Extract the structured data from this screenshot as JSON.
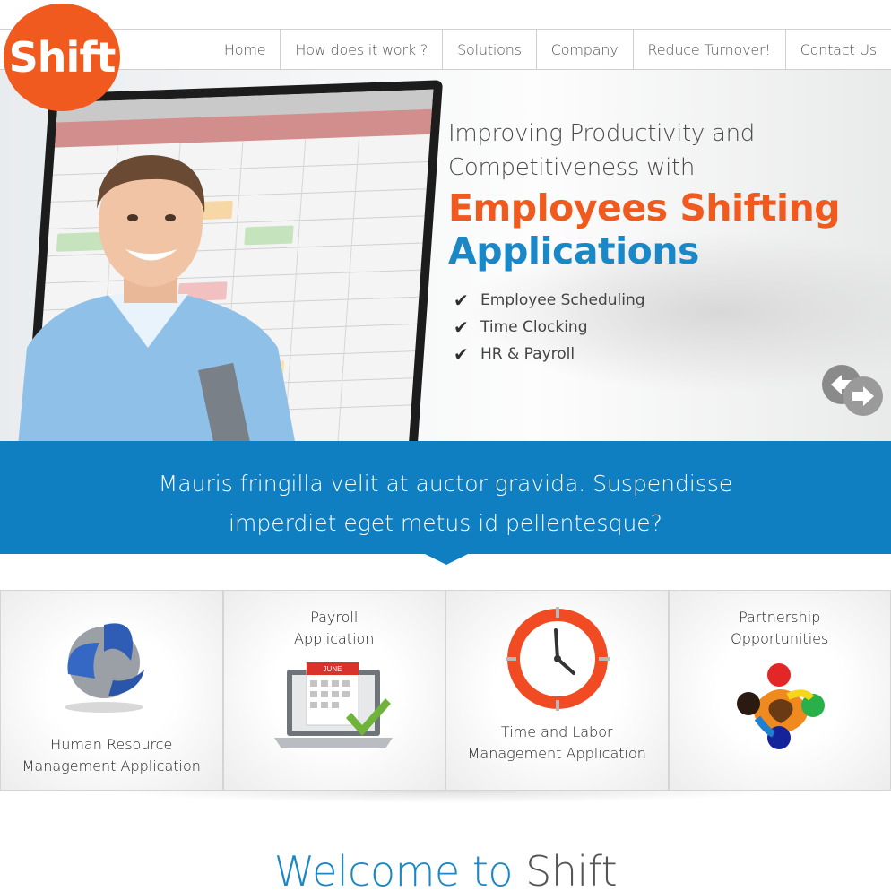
{
  "brand": {
    "logo_text": "Shift",
    "accent_orange": "#f05a1e",
    "accent_blue": "#0f7fc2"
  },
  "nav": {
    "items": [
      {
        "label": "Home"
      },
      {
        "label": "How does it work ?"
      },
      {
        "label": "Solutions"
      },
      {
        "label": "Company"
      },
      {
        "label": "Reduce Turnover!"
      },
      {
        "label": "Contact Us"
      }
    ]
  },
  "hero": {
    "intro_line1": "Improving Productivity and",
    "intro_line2": "Competitiveness with",
    "headline_orange": "Employees Shifting",
    "headline_blue": "Applications",
    "checks": [
      {
        "label": "Employee Scheduling"
      },
      {
        "label": "Time Clocking"
      },
      {
        "label": "HR & Payroll"
      }
    ],
    "slider_icon": "prev-next-arrows-icon"
  },
  "banner": {
    "line1": "Mauris fringilla velit at auctor gravida. Suspendisse",
    "line2": "imperdiet eget metus id pellentesque?"
  },
  "features": [
    {
      "label1": "Human Resource",
      "label2": "Management Application",
      "icon": "hr-swirl-icon"
    },
    {
      "label1": "Payroll",
      "label2": "Application",
      "icon": "payroll-laptop-calendar-icon"
    },
    {
      "label1": "Time and Labor",
      "label2": "Management Application",
      "icon": "clock-icon"
    },
    {
      "label1": "Partnership",
      "label2": "Opportunities",
      "icon": "partnership-people-icon"
    }
  ],
  "calendar_month": "JUNE",
  "welcome": {
    "part1": "Welcome to",
    "part2": "Shift"
  }
}
